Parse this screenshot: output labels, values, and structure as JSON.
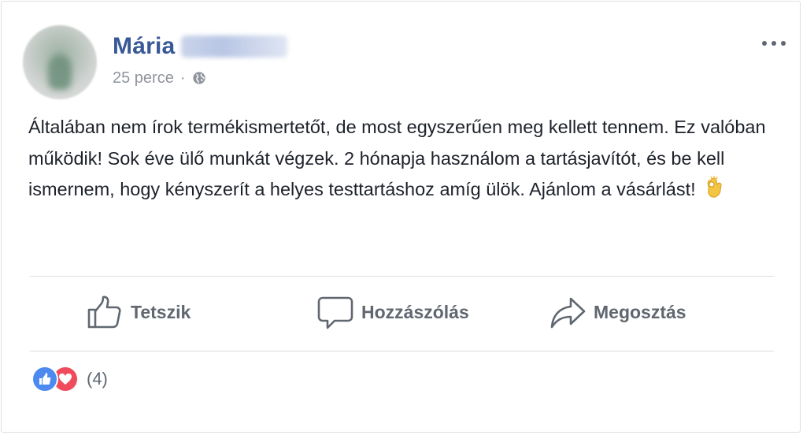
{
  "post": {
    "author_first_name": "Mária",
    "timestamp": "25 perce",
    "separator": "·",
    "privacy_icon": "globe-icon",
    "more_icon": "ellipsis-icon",
    "text": "Általában nem írok termékismertetőt, de most egyszerűen meg kellett tennem. Ez valóban működik! Sok éve ülő munkát végzek. 2 hónapja használom a tartásjavítót, és be kell ismernem, hogy kényszerít a helyes testtartáshoz amíg ülök. Ajánlom a vásárlást!",
    "emoji": "ok-hand-emoji"
  },
  "actions": {
    "like_label": "Tetszik",
    "comment_label": "Hozzászólás",
    "share_label": "Megosztás"
  },
  "reactions": {
    "types": [
      "like",
      "love"
    ],
    "count_text": "(4)"
  },
  "colors": {
    "name": "#385898",
    "meta": "#90949c",
    "action": "#606770",
    "like_reaction": "#4d8af0",
    "love_reaction": "#ef4b5c"
  }
}
